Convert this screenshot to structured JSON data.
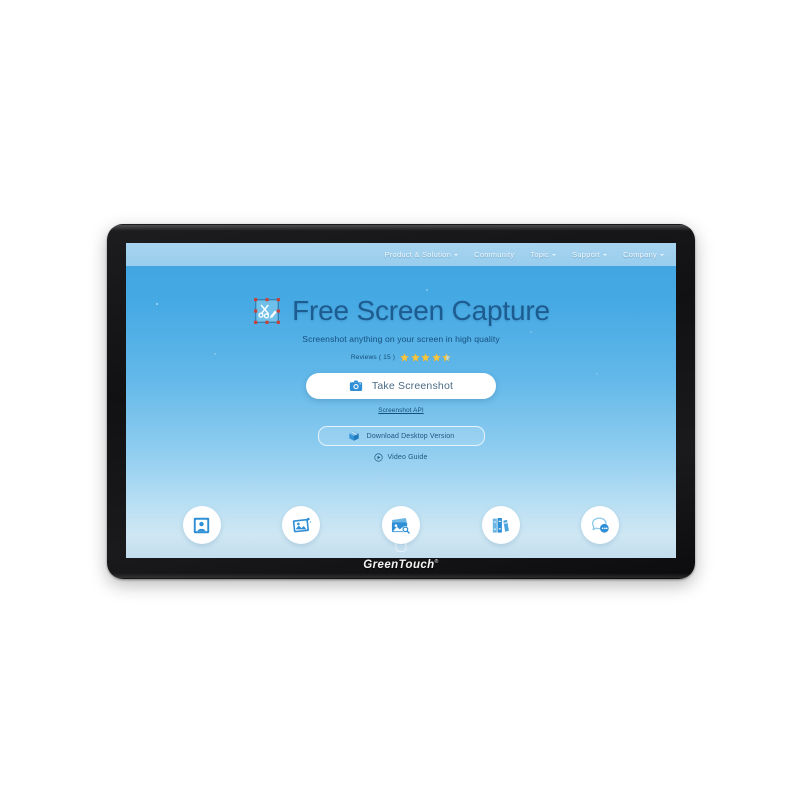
{
  "device": {
    "brand": "GreenTouch",
    "trademark": "®"
  },
  "nav": {
    "items": [
      {
        "label": "Product & Solution",
        "has_dropdown": true
      },
      {
        "label": "Community",
        "has_dropdown": false
      },
      {
        "label": "Topic",
        "has_dropdown": true
      },
      {
        "label": "Support",
        "has_dropdown": true
      },
      {
        "label": "Company",
        "has_dropdown": true
      }
    ]
  },
  "hero": {
    "logo_icon": "crop-scissors-icon",
    "title": "Free Screen Capture",
    "subtitle": "Screenshot anything on your screen in high quality",
    "reviews_label": "Reviews ( 15 )",
    "reviews_count": 15,
    "rating": 4.5,
    "stars_total": 5,
    "primary_button": {
      "label": "Take Screenshot",
      "icon": "camera-icon"
    },
    "api_link": "Screenshot API",
    "secondary_button": {
      "label": "Download Desktop Version",
      "icon": "box-download-icon"
    },
    "video_guide": {
      "label": "Video Guide",
      "icon": "play-circle-icon"
    }
  },
  "shortcuts": [
    {
      "name": "avatar-card-icon",
      "title": "Profile"
    },
    {
      "name": "image-icon",
      "title": "Image"
    },
    {
      "name": "image-search-icon",
      "title": "Image Search"
    },
    {
      "name": "books-icon",
      "title": "Library"
    },
    {
      "name": "chat-bubble-icon",
      "title": "Chat"
    }
  ],
  "colors": {
    "page_background": "#ffffff",
    "bezel": "#151517",
    "screen_top": "#3ea3e0",
    "screen_bottom": "#c3ddee",
    "nav_band": "#a5d3ef",
    "title_text": "#1d5c91",
    "accent_blue": "#2f8fd6",
    "star_gold": "#f5c842",
    "button_white": "#ffffff"
  }
}
